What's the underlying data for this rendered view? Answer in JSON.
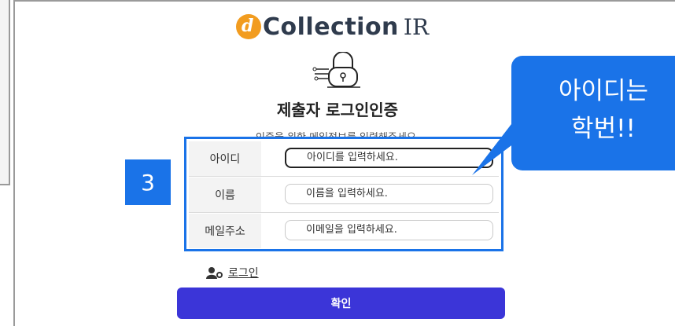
{
  "logo": {
    "mark_letter": "d",
    "name": "Collection",
    "suffix": "IR"
  },
  "title": "제출자 로그인인증",
  "subtitle": "인증을 위한 메일정보를 입력해주세요.",
  "form": {
    "rows": [
      {
        "label": "아이디",
        "placeholder": "아이디를 입력하세요."
      },
      {
        "label": "이름",
        "placeholder": "이름을 입력하세요."
      },
      {
        "label": "메일주소",
        "placeholder": "이메일을 입력하세요."
      }
    ]
  },
  "annotation": {
    "step_number": "3",
    "callout_line1": "아이디는",
    "callout_line2": "학번!!"
  },
  "login_link": {
    "label": "로그인",
    "icon": "user-key-icon"
  },
  "confirm_button": {
    "label": "확인"
  },
  "colors": {
    "accent": "#1a73e8",
    "button": "#3b35d8",
    "logo_orange": "#f29c1f"
  }
}
